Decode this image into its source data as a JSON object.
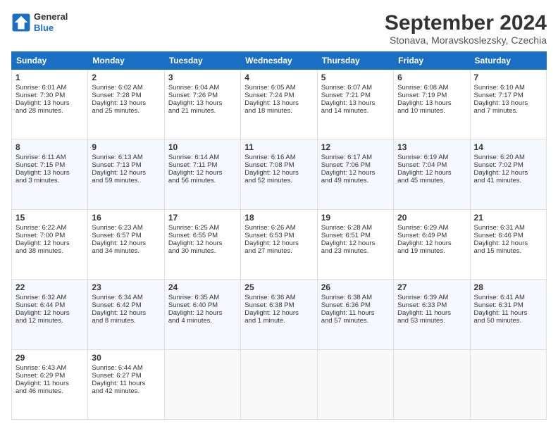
{
  "header": {
    "logo_line1": "General",
    "logo_line2": "Blue",
    "title": "September 2024",
    "subtitle": "Stonava, Moravskoslezsky, Czechia"
  },
  "weekdays": [
    "Sunday",
    "Monday",
    "Tuesday",
    "Wednesday",
    "Thursday",
    "Friday",
    "Saturday"
  ],
  "weeks": [
    [
      {
        "day": "1",
        "lines": [
          "Sunrise: 6:01 AM",
          "Sunset: 7:30 PM",
          "Daylight: 13 hours",
          "and 28 minutes."
        ]
      },
      {
        "day": "2",
        "lines": [
          "Sunrise: 6:02 AM",
          "Sunset: 7:28 PM",
          "Daylight: 13 hours",
          "and 25 minutes."
        ]
      },
      {
        "day": "3",
        "lines": [
          "Sunrise: 6:04 AM",
          "Sunset: 7:26 PM",
          "Daylight: 13 hours",
          "and 21 minutes."
        ]
      },
      {
        "day": "4",
        "lines": [
          "Sunrise: 6:05 AM",
          "Sunset: 7:24 PM",
          "Daylight: 13 hours",
          "and 18 minutes."
        ]
      },
      {
        "day": "5",
        "lines": [
          "Sunrise: 6:07 AM",
          "Sunset: 7:21 PM",
          "Daylight: 13 hours",
          "and 14 minutes."
        ]
      },
      {
        "day": "6",
        "lines": [
          "Sunrise: 6:08 AM",
          "Sunset: 7:19 PM",
          "Daylight: 13 hours",
          "and 10 minutes."
        ]
      },
      {
        "day": "7",
        "lines": [
          "Sunrise: 6:10 AM",
          "Sunset: 7:17 PM",
          "Daylight: 13 hours",
          "and 7 minutes."
        ]
      }
    ],
    [
      {
        "day": "8",
        "lines": [
          "Sunrise: 6:11 AM",
          "Sunset: 7:15 PM",
          "Daylight: 13 hours",
          "and 3 minutes."
        ]
      },
      {
        "day": "9",
        "lines": [
          "Sunrise: 6:13 AM",
          "Sunset: 7:13 PM",
          "Daylight: 12 hours",
          "and 59 minutes."
        ]
      },
      {
        "day": "10",
        "lines": [
          "Sunrise: 6:14 AM",
          "Sunset: 7:11 PM",
          "Daylight: 12 hours",
          "and 56 minutes."
        ]
      },
      {
        "day": "11",
        "lines": [
          "Sunrise: 6:16 AM",
          "Sunset: 7:08 PM",
          "Daylight: 12 hours",
          "and 52 minutes."
        ]
      },
      {
        "day": "12",
        "lines": [
          "Sunrise: 6:17 AM",
          "Sunset: 7:06 PM",
          "Daylight: 12 hours",
          "and 49 minutes."
        ]
      },
      {
        "day": "13",
        "lines": [
          "Sunrise: 6:19 AM",
          "Sunset: 7:04 PM",
          "Daylight: 12 hours",
          "and 45 minutes."
        ]
      },
      {
        "day": "14",
        "lines": [
          "Sunrise: 6:20 AM",
          "Sunset: 7:02 PM",
          "Daylight: 12 hours",
          "and 41 minutes."
        ]
      }
    ],
    [
      {
        "day": "15",
        "lines": [
          "Sunrise: 6:22 AM",
          "Sunset: 7:00 PM",
          "Daylight: 12 hours",
          "and 38 minutes."
        ]
      },
      {
        "day": "16",
        "lines": [
          "Sunrise: 6:23 AM",
          "Sunset: 6:57 PM",
          "Daylight: 12 hours",
          "and 34 minutes."
        ]
      },
      {
        "day": "17",
        "lines": [
          "Sunrise: 6:25 AM",
          "Sunset: 6:55 PM",
          "Daylight: 12 hours",
          "and 30 minutes."
        ]
      },
      {
        "day": "18",
        "lines": [
          "Sunrise: 6:26 AM",
          "Sunset: 6:53 PM",
          "Daylight: 12 hours",
          "and 27 minutes."
        ]
      },
      {
        "day": "19",
        "lines": [
          "Sunrise: 6:28 AM",
          "Sunset: 6:51 PM",
          "Daylight: 12 hours",
          "and 23 minutes."
        ]
      },
      {
        "day": "20",
        "lines": [
          "Sunrise: 6:29 AM",
          "Sunset: 6:49 PM",
          "Daylight: 12 hours",
          "and 19 minutes."
        ]
      },
      {
        "day": "21",
        "lines": [
          "Sunrise: 6:31 AM",
          "Sunset: 6:46 PM",
          "Daylight: 12 hours",
          "and 15 minutes."
        ]
      }
    ],
    [
      {
        "day": "22",
        "lines": [
          "Sunrise: 6:32 AM",
          "Sunset: 6:44 PM",
          "Daylight: 12 hours",
          "and 12 minutes."
        ]
      },
      {
        "day": "23",
        "lines": [
          "Sunrise: 6:34 AM",
          "Sunset: 6:42 PM",
          "Daylight: 12 hours",
          "and 8 minutes."
        ]
      },
      {
        "day": "24",
        "lines": [
          "Sunrise: 6:35 AM",
          "Sunset: 6:40 PM",
          "Daylight: 12 hours",
          "and 4 minutes."
        ]
      },
      {
        "day": "25",
        "lines": [
          "Sunrise: 6:36 AM",
          "Sunset: 6:38 PM",
          "Daylight: 12 hours",
          "and 1 minute."
        ]
      },
      {
        "day": "26",
        "lines": [
          "Sunrise: 6:38 AM",
          "Sunset: 6:36 PM",
          "Daylight: 11 hours",
          "and 57 minutes."
        ]
      },
      {
        "day": "27",
        "lines": [
          "Sunrise: 6:39 AM",
          "Sunset: 6:33 PM",
          "Daylight: 11 hours",
          "and 53 minutes."
        ]
      },
      {
        "day": "28",
        "lines": [
          "Sunrise: 6:41 AM",
          "Sunset: 6:31 PM",
          "Daylight: 11 hours",
          "and 50 minutes."
        ]
      }
    ],
    [
      {
        "day": "29",
        "lines": [
          "Sunrise: 6:43 AM",
          "Sunset: 6:29 PM",
          "Daylight: 11 hours",
          "and 46 minutes."
        ]
      },
      {
        "day": "30",
        "lines": [
          "Sunrise: 6:44 AM",
          "Sunset: 6:27 PM",
          "Daylight: 11 hours",
          "and 42 minutes."
        ]
      },
      {
        "day": "",
        "lines": []
      },
      {
        "day": "",
        "lines": []
      },
      {
        "day": "",
        "lines": []
      },
      {
        "day": "",
        "lines": []
      },
      {
        "day": "",
        "lines": []
      }
    ]
  ]
}
